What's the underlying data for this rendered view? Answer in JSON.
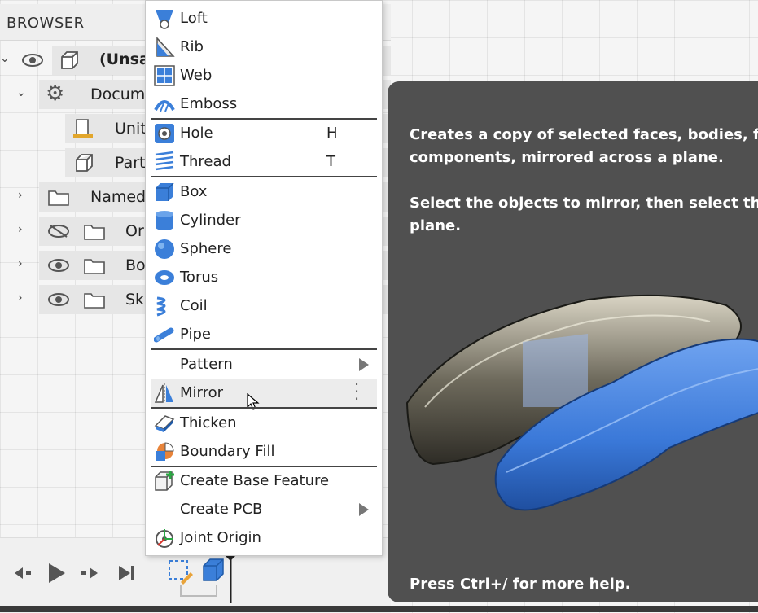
{
  "browser": {
    "title": "BROWSER",
    "rows": [
      {
        "label": "(Unsa"
      },
      {
        "label": "Docum"
      },
      {
        "label": "Unit"
      },
      {
        "label": "Part"
      },
      {
        "label": "Named"
      },
      {
        "label": "Or"
      },
      {
        "label": "Bo"
      },
      {
        "label": "Sk"
      }
    ]
  },
  "menu": {
    "items": [
      {
        "label": "Loft",
        "icon": "loft-icon"
      },
      {
        "label": "Rib",
        "icon": "rib-icon"
      },
      {
        "label": "Web",
        "icon": "web-icon"
      },
      {
        "label": "Emboss",
        "icon": "emboss-icon"
      },
      {
        "label": "Hole",
        "key": "H",
        "icon": "hole-icon"
      },
      {
        "label": "Thread",
        "key": "T",
        "icon": "thread-icon"
      },
      {
        "label": "Box",
        "icon": "box-icon"
      },
      {
        "label": "Cylinder",
        "icon": "cylinder-icon"
      },
      {
        "label": "Sphere",
        "icon": "sphere-icon"
      },
      {
        "label": "Torus",
        "icon": "torus-icon"
      },
      {
        "label": "Coil",
        "icon": "coil-icon"
      },
      {
        "label": "Pipe",
        "icon": "pipe-icon"
      },
      {
        "label": "Pattern",
        "submenu": true
      },
      {
        "label": "Mirror",
        "icon": "mirror-icon",
        "highlighted": true
      },
      {
        "label": "Thicken",
        "icon": "thicken-icon"
      },
      {
        "label": "Boundary Fill",
        "icon": "boundary-fill-icon"
      },
      {
        "label": "Create Base Feature",
        "icon": "base-feature-icon"
      },
      {
        "label": "Create PCB",
        "submenu": true
      },
      {
        "label": "Joint Origin",
        "icon": "joint-origin-icon"
      }
    ]
  },
  "tooltip": {
    "description_line1": "Creates a copy of selected faces, bodies, fea",
    "description_line2": "components, mirrored across a plane.",
    "instruction_line1": "Select the objects to mirror, then select the",
    "instruction_line2": "plane.",
    "help": "Press Ctrl+/ for more help."
  },
  "colors": {
    "accent_blue": "#3b7fd9",
    "tooltip_bg": "#505050",
    "highlight": "#ececec"
  }
}
